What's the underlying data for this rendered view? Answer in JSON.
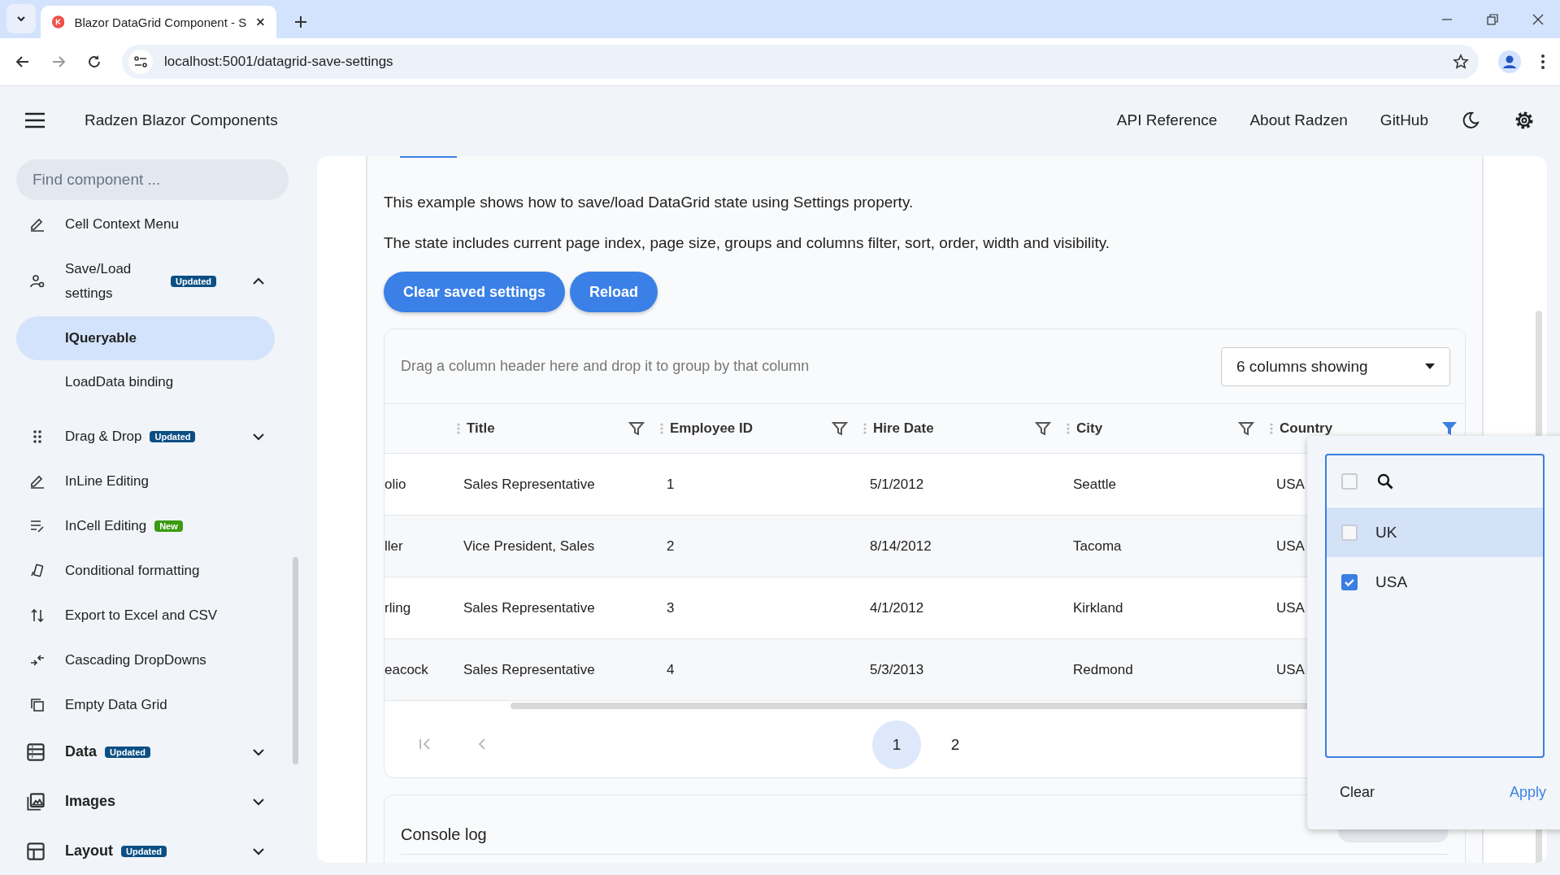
{
  "browser": {
    "tab_title": "Blazor DataGrid Component - S",
    "url": "localhost:5001/datagrid-save-settings"
  },
  "header": {
    "title": "Radzen Blazor Components",
    "links": [
      "API Reference",
      "About Radzen",
      "GitHub"
    ]
  },
  "sidebar": {
    "search_placeholder": "Find component ...",
    "items": [
      {
        "kind": "item",
        "label": "Cell Context Menu"
      },
      {
        "kind": "item",
        "label": "Save/Load settings",
        "badge": {
          "kind": "updated",
          "text": "Updated"
        },
        "expanded": true,
        "children": [
          {
            "label": "IQueryable",
            "selected": true
          },
          {
            "label": "LoadData binding",
            "selected": false
          }
        ]
      },
      {
        "kind": "item",
        "label": "Drag & Drop",
        "badge": {
          "kind": "updated",
          "text": "Updated"
        },
        "expanded": false
      },
      {
        "kind": "item",
        "label": "InLine Editing"
      },
      {
        "kind": "item",
        "label": "InCell Editing",
        "badge": {
          "kind": "new",
          "text": "New"
        }
      },
      {
        "kind": "item",
        "label": "Conditional formatting"
      },
      {
        "kind": "item",
        "label": "Export to Excel and CSV"
      },
      {
        "kind": "item",
        "label": "Cascading DropDowns"
      },
      {
        "kind": "item",
        "label": "Empty Data Grid"
      },
      {
        "kind": "section",
        "label": "Data",
        "badge": {
          "kind": "updated",
          "text": "Updated"
        },
        "expanded": false
      },
      {
        "kind": "section",
        "label": "Images",
        "expanded": false
      },
      {
        "kind": "section",
        "label": "Layout",
        "badge": {
          "kind": "updated",
          "text": "Updated"
        },
        "expanded": false
      }
    ]
  },
  "content": {
    "paragraphs": [
      "This example shows how to save/load DataGrid state using Settings property.",
      "The state includes current page index, page size, groups and columns filter, sort, order, width and visibility."
    ],
    "buttons": [
      "Clear saved settings",
      "Reload"
    ]
  },
  "grid": {
    "group_placeholder": "Drag a column header here and drop it to group by that column",
    "column_picker": "6 columns showing",
    "columns": [
      {
        "kind": "cut"
      },
      {
        "kind": "text",
        "label": "Title",
        "filtered": false
      },
      {
        "kind": "text",
        "label": "Employee ID",
        "filtered": false
      },
      {
        "kind": "text",
        "label": "Hire Date",
        "filtered": false
      },
      {
        "kind": "text",
        "label": "City",
        "filtered": false
      },
      {
        "kind": "text",
        "label": "Country",
        "filtered": true
      }
    ],
    "rows": [
      {
        "cells": [
          "olio",
          "Sales Representative",
          "1",
          "5/1/2012",
          "Seattle",
          "USA"
        ]
      },
      {
        "cells": [
          "ller",
          "Vice President, Sales",
          "2",
          "8/14/2012",
          "Tacoma",
          "USA"
        ]
      },
      {
        "cells": [
          "rling",
          "Sales Representative",
          "3",
          "4/1/2012",
          "Kirkland",
          "USA"
        ]
      },
      {
        "cells": [
          "eacock",
          "Sales Representative",
          "4",
          "5/3/2013",
          "Redmond",
          "USA"
        ]
      }
    ],
    "pager": {
      "pages": [
        {
          "label": "1",
          "selected": true
        },
        {
          "label": "2",
          "selected": false
        }
      ]
    }
  },
  "console": {
    "title": "Console log"
  },
  "filter_popup": {
    "select_all_checked": false,
    "options": [
      {
        "label": "UK",
        "checked": false,
        "highlighted": true
      },
      {
        "label": "USA",
        "checked": true,
        "highlighted": false
      }
    ],
    "clear": "Clear",
    "apply": "Apply"
  }
}
